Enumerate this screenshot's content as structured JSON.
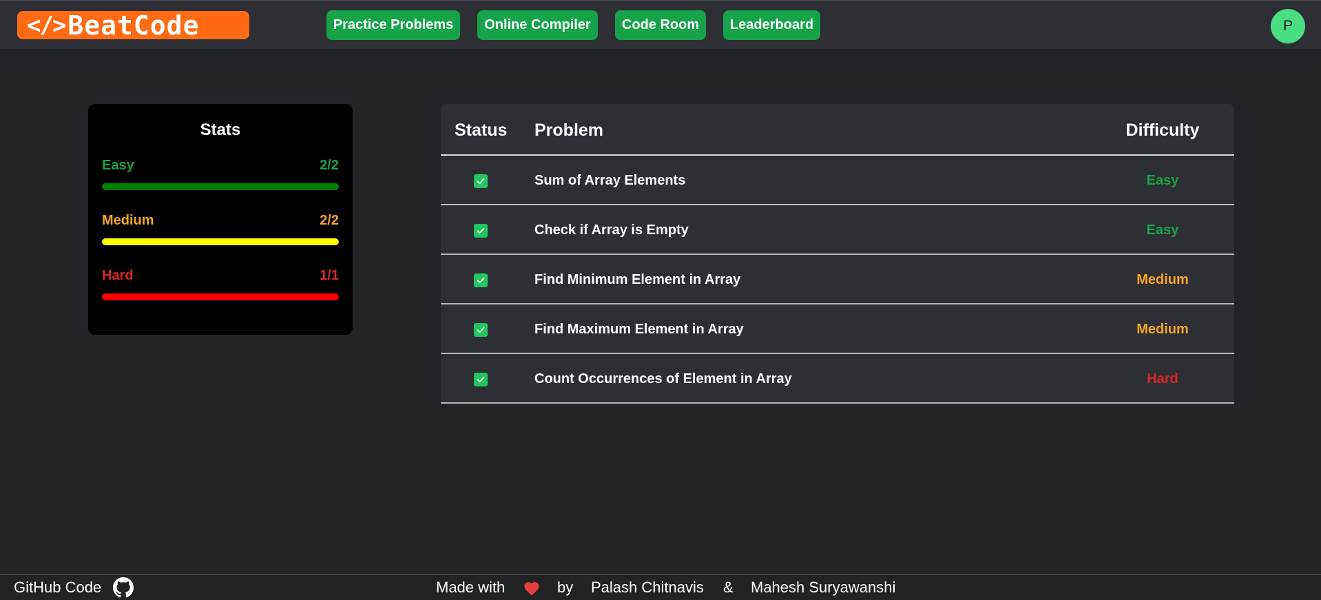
{
  "header": {
    "logo_mark": "</>",
    "logo_text": "BeatCode",
    "nav": [
      {
        "label": "Practice Problems"
      },
      {
        "label": "Online Compiler"
      },
      {
        "label": "Code Room"
      },
      {
        "label": "Leaderboard"
      }
    ],
    "avatar_initial": "P"
  },
  "stats": {
    "title": "Stats",
    "rows": [
      {
        "label": "Easy",
        "count": "2/2",
        "progress": 1.0,
        "label_color": "#16a34a",
        "bar_color": "#008000"
      },
      {
        "label": "Medium",
        "count": "2/2",
        "progress": 1.0,
        "label_color": "#f5a623",
        "bar_color": "#ffff00"
      },
      {
        "label": "Hard",
        "count": "1/1",
        "progress": 1.0,
        "label_color": "#dc2626",
        "bar_color": "#ff0000"
      }
    ]
  },
  "table": {
    "headers": {
      "status": "Status",
      "problem": "Problem",
      "difficulty": "Difficulty"
    },
    "rows": [
      {
        "solved": true,
        "name": "Sum of Array Elements",
        "difficulty": "Easy"
      },
      {
        "solved": true,
        "name": "Check if Array is Empty",
        "difficulty": "Easy"
      },
      {
        "solved": true,
        "name": "Find Minimum Element in Array",
        "difficulty": "Medium"
      },
      {
        "solved": true,
        "name": "Find Maximum Element in Array",
        "difficulty": "Medium"
      },
      {
        "solved": true,
        "name": "Count Occurrences of Element in Array",
        "difficulty": "Hard"
      }
    ],
    "difficulty_colors": {
      "Easy": "#16a34a",
      "Medium": "#f5a623",
      "Hard": "#dc2626"
    }
  },
  "footer": {
    "github_label": "GitHub Code",
    "made_with": "Made with",
    "by": "by",
    "author1": "Palash Chitnavis",
    "amp": "&",
    "author2": "Mahesh Suryawanshi",
    "heart_color": "#e53e3e"
  }
}
